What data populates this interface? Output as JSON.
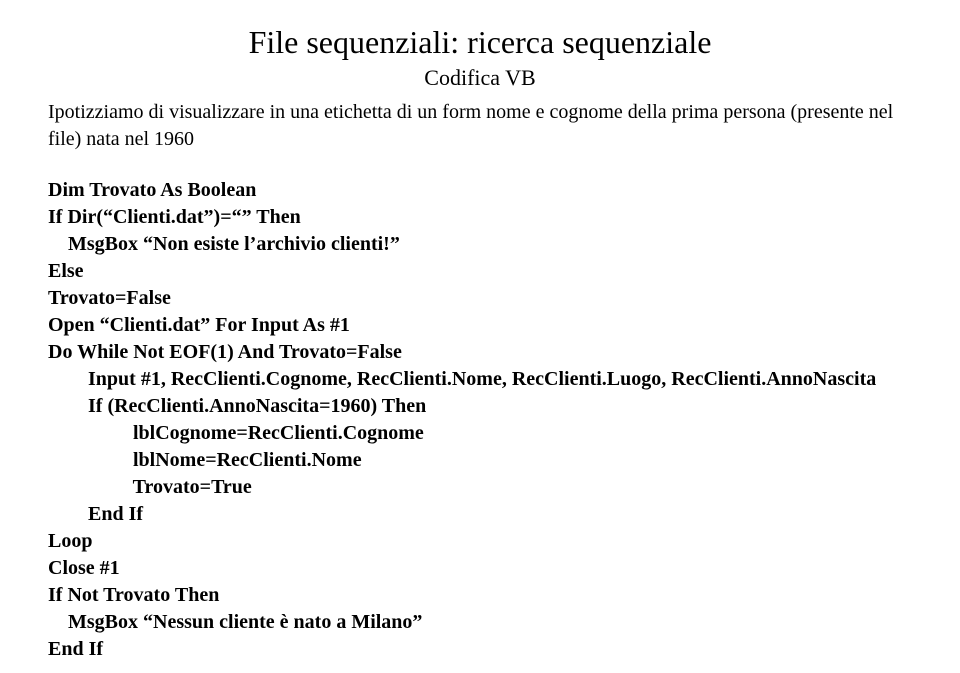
{
  "header": {
    "title": "File sequenziali: ricerca sequenziale",
    "subtitle": "Codifica VB"
  },
  "intro": "Ipotizziamo di visualizzare in una etichetta di un form nome e cognome della prima persona (presente nel file) nata nel 1960",
  "code": {
    "lines": {
      "l0": "Dim Trovato As Boolean",
      "l1": "If Dir(“Clienti.dat”)=“” Then",
      "l2": "    MsgBox “Non esiste l’archivio clienti!”",
      "l3": "Else",
      "l4": "Trovato=False",
      "l5": "Open “Clienti.dat” For Input As #1",
      "l6": "Do While Not EOF(1) And Trovato=False",
      "l7": "        Input #1, RecClienti.Cognome, RecClienti.Nome, RecClienti.Luogo, RecClienti.AnnoNascita",
      "l8": "        If (RecClienti.AnnoNascita=1960) Then",
      "l9": "                 lblCognome=RecClienti.Cognome",
      "l10": "                 lblNome=RecClienti.Nome",
      "l11": "                 Trovato=True",
      "l12": "        End If",
      "l13": "Loop",
      "l14": "Close #1",
      "l15": "If Not Trovato Then",
      "l16": "    MsgBox “Nessun cliente è nato a Milano”",
      "l17": "End If"
    }
  }
}
